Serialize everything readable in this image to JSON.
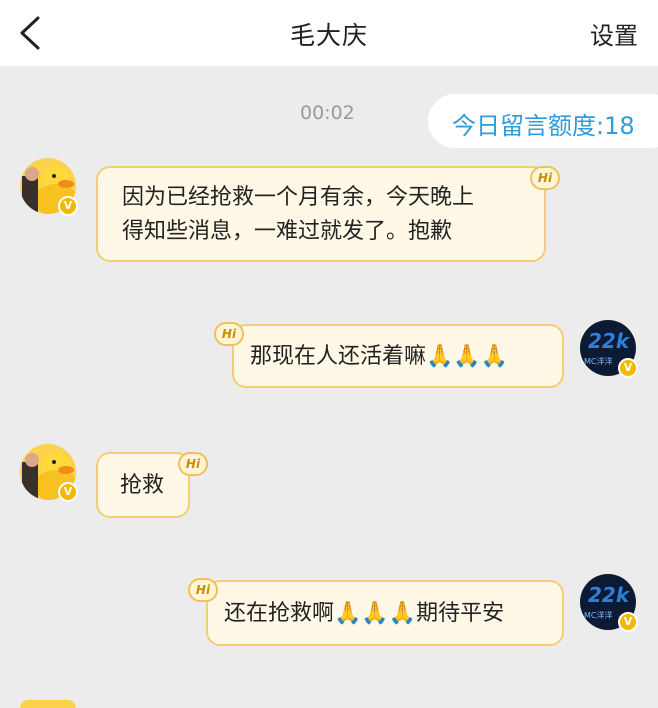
{
  "header": {
    "title": "毛大庆",
    "settings_label": "设置",
    "back_icon": "chevron-left-icon"
  },
  "timestamp": "00:02",
  "quota_label": "今日留言额度:18",
  "messages": [
    {
      "side": "left",
      "text": "因为已经抢救一个月有余，今天晚上\n得知些消息，一难过就发了。抱歉",
      "badge": "Hi",
      "avatar": "duck-avatar",
      "verified": true
    },
    {
      "side": "right",
      "text": "那现在人还活着嘛🙏🙏🙏",
      "badge": "Hi",
      "avatar": "mc-avatar",
      "verified": true
    },
    {
      "side": "left",
      "text": "抢救",
      "badge": "Hi",
      "avatar": "duck-avatar",
      "verified": true
    },
    {
      "side": "right",
      "text": "还在抢救啊🙏🙏🙏期待平安",
      "badge": "Hi",
      "avatar": "mc-avatar",
      "verified": true
    }
  ],
  "colors": {
    "background": "#ececec",
    "bubble_fill": "#fff8e6",
    "bubble_border": "#f2cf75",
    "quota_text": "#2f9cdb",
    "verified_badge": "#f5b800"
  }
}
